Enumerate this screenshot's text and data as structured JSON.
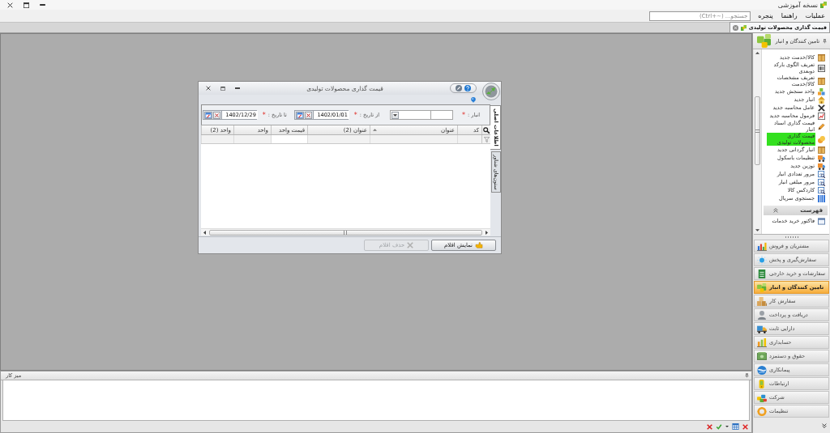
{
  "window": {
    "title": "نسخه آموزشی"
  },
  "menu": {
    "items": [
      {
        "label": "عملیات"
      },
      {
        "label": "راهنما"
      },
      {
        "label": "پنجره"
      }
    ],
    "search": {
      "placeholder": "جستجو... (~+Ctrl)"
    }
  },
  "document_tabs": [
    {
      "label": "قیمت گذاری محصولات تولیدی",
      "selected": true
    }
  ],
  "dialog": {
    "title": "قیمت گذاری محصولات تولیدی",
    "side_tabs": [
      {
        "label": "اطلاعات اصلی",
        "selected": true
      },
      {
        "label": "ستون‌های شناور",
        "selected": false
      }
    ],
    "filters": [
      {
        "kind": "lookup",
        "label": "انبار :",
        "marker": "*"
      },
      {
        "kind": "date",
        "label": "از تاریخ :",
        "marker": "*",
        "value": "1402/01/01"
      },
      {
        "kind": "date",
        "label": "تا تاریخ :",
        "marker": "*",
        "value": "1402/12/29"
      }
    ],
    "table": {
      "columns": [
        {
          "label": "کد",
          "sorted": false,
          "filter_focused": false
        },
        {
          "label": "عنوان",
          "sorted": true,
          "filter_focused": false
        },
        {
          "label": "عنوان (2)",
          "sorted": false,
          "filter_focused": false
        },
        {
          "label": "قیمت واحد",
          "sorted": false,
          "filter_focused": true
        },
        {
          "label": "واحد",
          "sorted": false,
          "filter_focused": false
        },
        {
          "label": "واحد (2)",
          "sorted": false,
          "filter_focused": false
        }
      ]
    },
    "buttons": [
      {
        "label": "نمایش اقلام",
        "disabled": false
      },
      {
        "label": "حذف اقلام",
        "disabled": true
      }
    ]
  },
  "workspace": {
    "title": "میز کار"
  },
  "sidebar": {
    "title": "تامین کنندگان و انبار",
    "items": [
      {
        "label": "کالا/خدمت جدید",
        "selected": false
      },
      {
        "label": "تعریف الگوی بارکد دوبعدی",
        "selected": false
      },
      {
        "label": "تعریف مشخصات کالا/خدمت",
        "selected": false
      },
      {
        "label": "واحد سنجش جدید",
        "selected": false
      },
      {
        "label": "انبار جدید",
        "selected": false
      },
      {
        "label": "عامل محاسبه جدید",
        "selected": false
      },
      {
        "label": "فرمول محاسبه جدید",
        "selected": false
      },
      {
        "label": "قیمت گذاری اسناد انبار",
        "selected": false
      },
      {
        "label": "قیمت گذاری محصولات تولیدی",
        "selected": true
      },
      {
        "label": "انبار گردانی جدید",
        "selected": false
      },
      {
        "label": "تنظیمات باسکول",
        "selected": false
      },
      {
        "label": "توزین جدید",
        "selected": false
      },
      {
        "label": "مرور تعدادی انبار",
        "selected": false
      },
      {
        "label": "مرور مبلغی انبار",
        "selected": false
      },
      {
        "label": "کاردکس کالا",
        "selected": false
      },
      {
        "label": "جستجوی سریال",
        "selected": false
      }
    ],
    "section": {
      "title": "فهرست",
      "expanded": true,
      "items": [
        {
          "label": "فاکتور خرید خدمات",
          "selected": false
        }
      ]
    },
    "modules": [
      {
        "label": "مشتریان و فروش",
        "selected": false
      },
      {
        "label": "سفارش‌گیری و پخش",
        "selected": false
      },
      {
        "label": "سفارشات و خرید خارجی",
        "selected": false
      },
      {
        "label": "تامین کنندگان و انبار",
        "selected": true
      },
      {
        "label": "سفارش کار",
        "selected": false
      },
      {
        "label": "دریافت و پرداخت",
        "selected": false
      },
      {
        "label": "دارایی ثابت",
        "selected": false
      },
      {
        "label": "حسابداری",
        "selected": false
      },
      {
        "label": "حقوق و دستمزد",
        "selected": false
      },
      {
        "label": "پیمانکاری",
        "selected": false
      },
      {
        "label": "ارتباطات",
        "selected": false
      },
      {
        "label": "شرکت",
        "selected": false
      },
      {
        "label": "تنظیمات",
        "selected": false
      }
    ]
  }
}
